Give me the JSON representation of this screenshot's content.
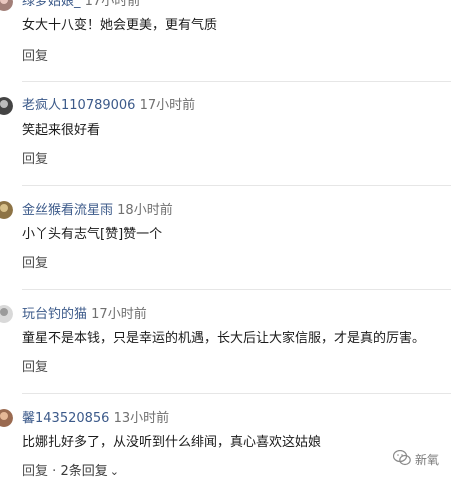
{
  "comments": [
    {
      "username": "绿萝姑娘_",
      "time": "17小时前",
      "text": "女大十八变！她会更美，更有气质",
      "reply": "回复"
    },
    {
      "username": "老疯人110789006",
      "time": "17小时前",
      "text": "笑起来很好看",
      "reply": "回复"
    },
    {
      "username": "金丝猴看流星雨",
      "time": "18小时前",
      "text": "小丫头有志气[赞]赞一个",
      "reply": "回复"
    },
    {
      "username": "玩台钓的猫",
      "time": "17小时前",
      "text": "童星不是本钱，只是幸运的机遇，长大后让大家信服，才是真的厉害。",
      "reply": "回复"
    },
    {
      "username": "馨143520856",
      "time": "13小时前",
      "text": "比娜扎好多了，从没听到什么绯闻，真心喜欢这姑娘",
      "reply": "回复",
      "reply_sep": "·",
      "more_replies": "2条回复"
    }
  ],
  "watermark": {
    "text": "新氧"
  },
  "colors": {
    "username": "#3c5a8a",
    "time": "#707070",
    "divider": "#e6e6e6"
  }
}
